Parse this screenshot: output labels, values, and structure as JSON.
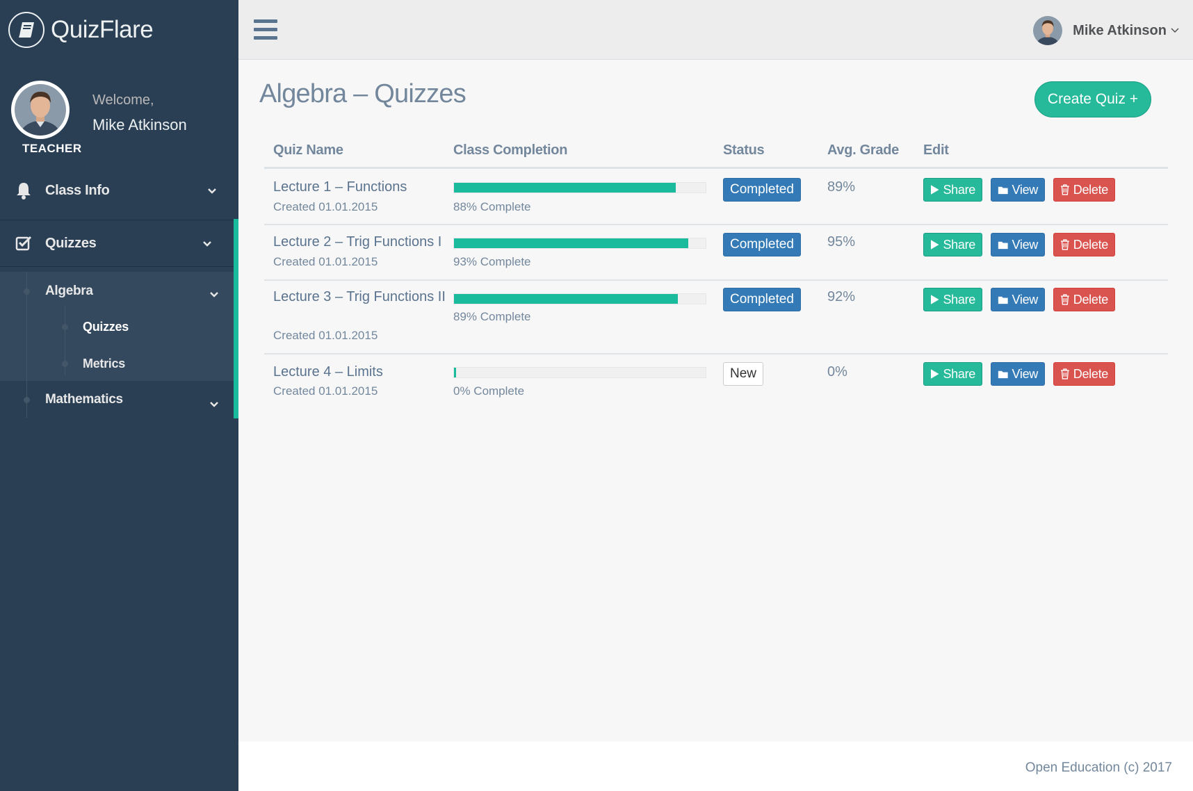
{
  "brand": {
    "name": "QuizFlare"
  },
  "profile": {
    "welcome": "Welcome,",
    "name": "Mike Atkinson",
    "role": "TEACHER"
  },
  "sidebar": {
    "class_info": "Class Info",
    "quizzes": "Quizzes",
    "algebra": "Algebra",
    "algebra_quizzes": "Quizzes",
    "algebra_metrics": "Metrics",
    "mathematics": "Mathematics"
  },
  "topbar": {
    "user_name": "Mike Atkinson"
  },
  "page": {
    "title": "Algebra – Quizzes",
    "create_button": "Create Quiz +"
  },
  "table": {
    "headers": [
      "Quiz Name",
      "Class Completion",
      "Status",
      "Avg. Grade",
      "Edit"
    ],
    "rows": [
      {
        "name": "Lecture 1 – Functions",
        "created": "Created 01.01.2015",
        "completion": 88,
        "completion_text": "88% Complete",
        "status": "Completed",
        "grade": "89%"
      },
      {
        "name": "Lecture 2 – Trig Functions I",
        "created": "Created 01.01.2015",
        "completion": 93,
        "completion_text": "93% Complete",
        "status": "Completed",
        "grade": "95%"
      },
      {
        "name": "Lecture 3 – Trig Functions II",
        "created": "Created 01.01.2015",
        "completion": 89,
        "completion_text": "89% Complete",
        "status": "Completed",
        "grade": "92%"
      },
      {
        "name": "Lecture 4 – Limits",
        "created": "Created 01.01.2015",
        "completion": 0,
        "completion_text": "0% Complete",
        "status": "New",
        "grade": "0%"
      }
    ],
    "actions": {
      "share": "Share",
      "view": "View",
      "delete": "Delete"
    }
  },
  "footer": {
    "text": "Open Education (c) 2017"
  },
  "colors": {
    "sidebar": "#2a3f54",
    "accent": "#1abb9c",
    "primary": "#337ab7",
    "danger": "#d9534f"
  },
  "icons": [
    "book-icon",
    "bell-icon",
    "checkbox-icon",
    "chevron-down-icon",
    "hamburger-icon",
    "play-icon",
    "folder-icon",
    "trash-icon"
  ]
}
